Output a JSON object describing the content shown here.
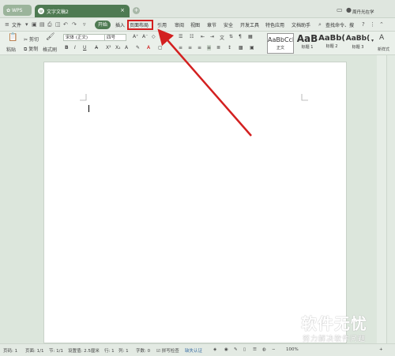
{
  "titlebar": {
    "app_tab": "WPS",
    "doc_tab": "文字文稿2",
    "doc_badge": "W",
    "user": "周丹光在学"
  },
  "menu": {
    "file": "文件",
    "start": "开始",
    "insert": "插入",
    "page_layout": "页面布局",
    "references": "引用",
    "review": "审阅",
    "view": "视图",
    "section": "章节",
    "security": "安全",
    "dev_tools": "开发工具",
    "special": "特色应用",
    "doc_helper": "文档助手",
    "search": "查找命令、搜"
  },
  "toolbar": {
    "paste": "粘贴",
    "cut": "剪切",
    "copy": "复制",
    "format_painter": "格式刷",
    "font_name": "宋体 (正文)",
    "font_size": "四号",
    "styles": [
      {
        "preview": "AaBbCcDd",
        "label": "正文"
      },
      {
        "preview": "AaB",
        "label": "标题 1"
      },
      {
        "preview": "AaBb(",
        "label": "标题 2"
      },
      {
        "preview": "AaBb(",
        "label": "标题 3"
      }
    ],
    "new_style": "新样式"
  },
  "status": {
    "page_no": "页码: 1",
    "page": "页面: 1/1",
    "section": "节: 1/1",
    "setting": "设置值: 2.5厘米",
    "row": "行: 1",
    "col": "列: 1",
    "words": "字数: 0",
    "spell": "拼写检查",
    "cert": "缺失认证",
    "zoom": "100%"
  },
  "watermark": {
    "main": "软件无忧",
    "sub": "努力解决软件问题"
  },
  "colors": {
    "accent": "#4e7a52",
    "highlight": "#d32020"
  }
}
